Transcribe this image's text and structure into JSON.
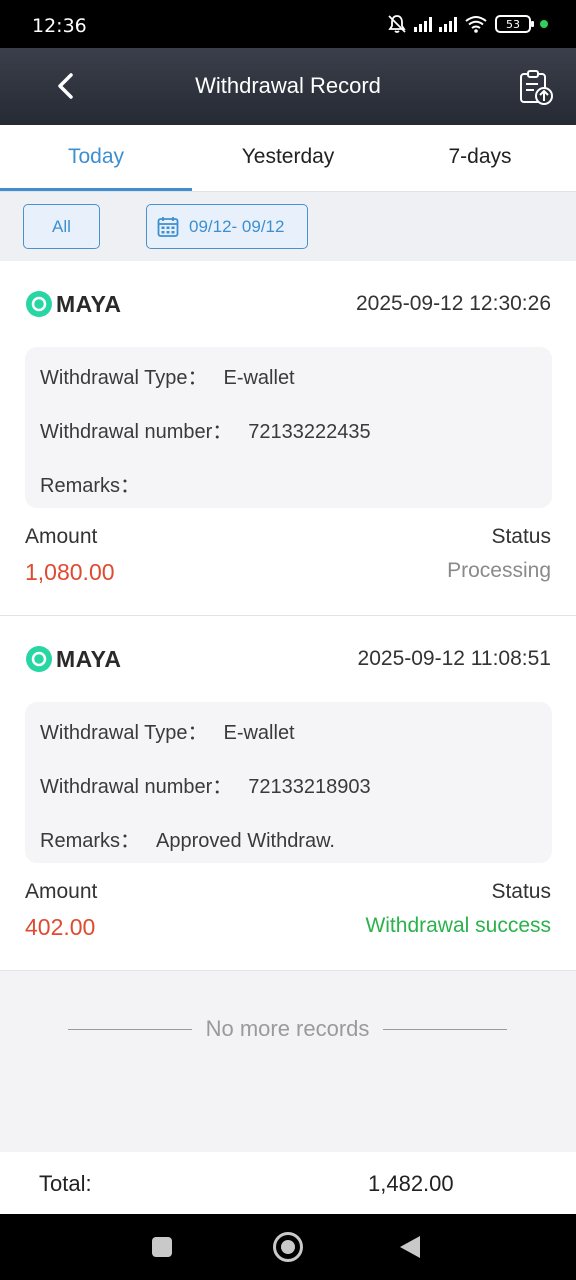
{
  "status_bar": {
    "time": "12:36",
    "battery": "53"
  },
  "header": {
    "title": "Withdrawal Record"
  },
  "tabs": [
    {
      "label": "Today",
      "active": true
    },
    {
      "label": "Yesterday",
      "active": false
    },
    {
      "label": "7-days",
      "active": false
    }
  ],
  "filters": {
    "all_label": "All",
    "date_range": "09/12- 09/12"
  },
  "records": [
    {
      "channel": "MAYA",
      "datetime": "2025-09-12 12:30:26",
      "type_label": "Withdrawal Type：",
      "type_value": "E-wallet",
      "number_label": "Withdrawal number：",
      "number_value": "72133222435",
      "remarks_label": "Remarks：",
      "remarks_value": "",
      "amount_label": "Amount",
      "amount": "1,080.00",
      "status_label": "Status",
      "status": "Processing",
      "status_color": "#8a8a8a"
    },
    {
      "channel": "MAYA",
      "datetime": "2025-09-12 11:08:51",
      "type_label": "Withdrawal Type：",
      "type_value": "E-wallet",
      "number_label": "Withdrawal number：",
      "number_value": "72133218903",
      "remarks_label": "Remarks：",
      "remarks_value": "Approved Withdraw.",
      "amount_label": "Amount",
      "amount": "402.00",
      "status_label": "Status",
      "status": "Withdrawal success",
      "status_color": "#2bb24c"
    }
  ],
  "footer_note": "No more records",
  "total": {
    "label": "Total:",
    "value": "1,482.00"
  },
  "colors": {
    "accent": "#3d8fd0",
    "amount": "#e04a30",
    "maya": "#27d6a3"
  },
  "icons": {
    "back": "chevron-left-icon",
    "export": "clipboard-upload-icon",
    "calendar": "calendar-icon",
    "maya": "maya-logo-icon"
  }
}
